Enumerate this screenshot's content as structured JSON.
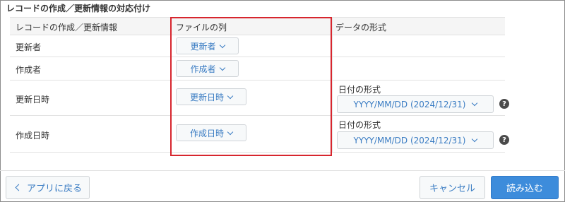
{
  "section_title": "レコードの作成／更新情報の対応付け",
  "table": {
    "headers": [
      "レコードの作成／更新情報",
      "ファイルの列",
      "データの形式"
    ],
    "rows": [
      {
        "label": "更新者",
        "column": "更新者"
      },
      {
        "label": "作成者",
        "column": "作成者"
      },
      {
        "label": "更新日時",
        "column": "更新日時",
        "format_label": "日付の形式",
        "format_value": "YYYY/MM/DD (2024/12/31)"
      },
      {
        "label": "作成日時",
        "column": "作成日時",
        "format_label": "日付の形式",
        "format_value": "YYYY/MM/DD (2024/12/31)"
      }
    ]
  },
  "help_glyph": "?",
  "footer": {
    "back_label": "アプリに戻る",
    "cancel_label": "キャンセル",
    "import_label": "読み込む"
  },
  "colors": {
    "accent": "#3a7cc3",
    "primary_button": "#3d8cdb",
    "highlight_border": "#d7262e"
  }
}
